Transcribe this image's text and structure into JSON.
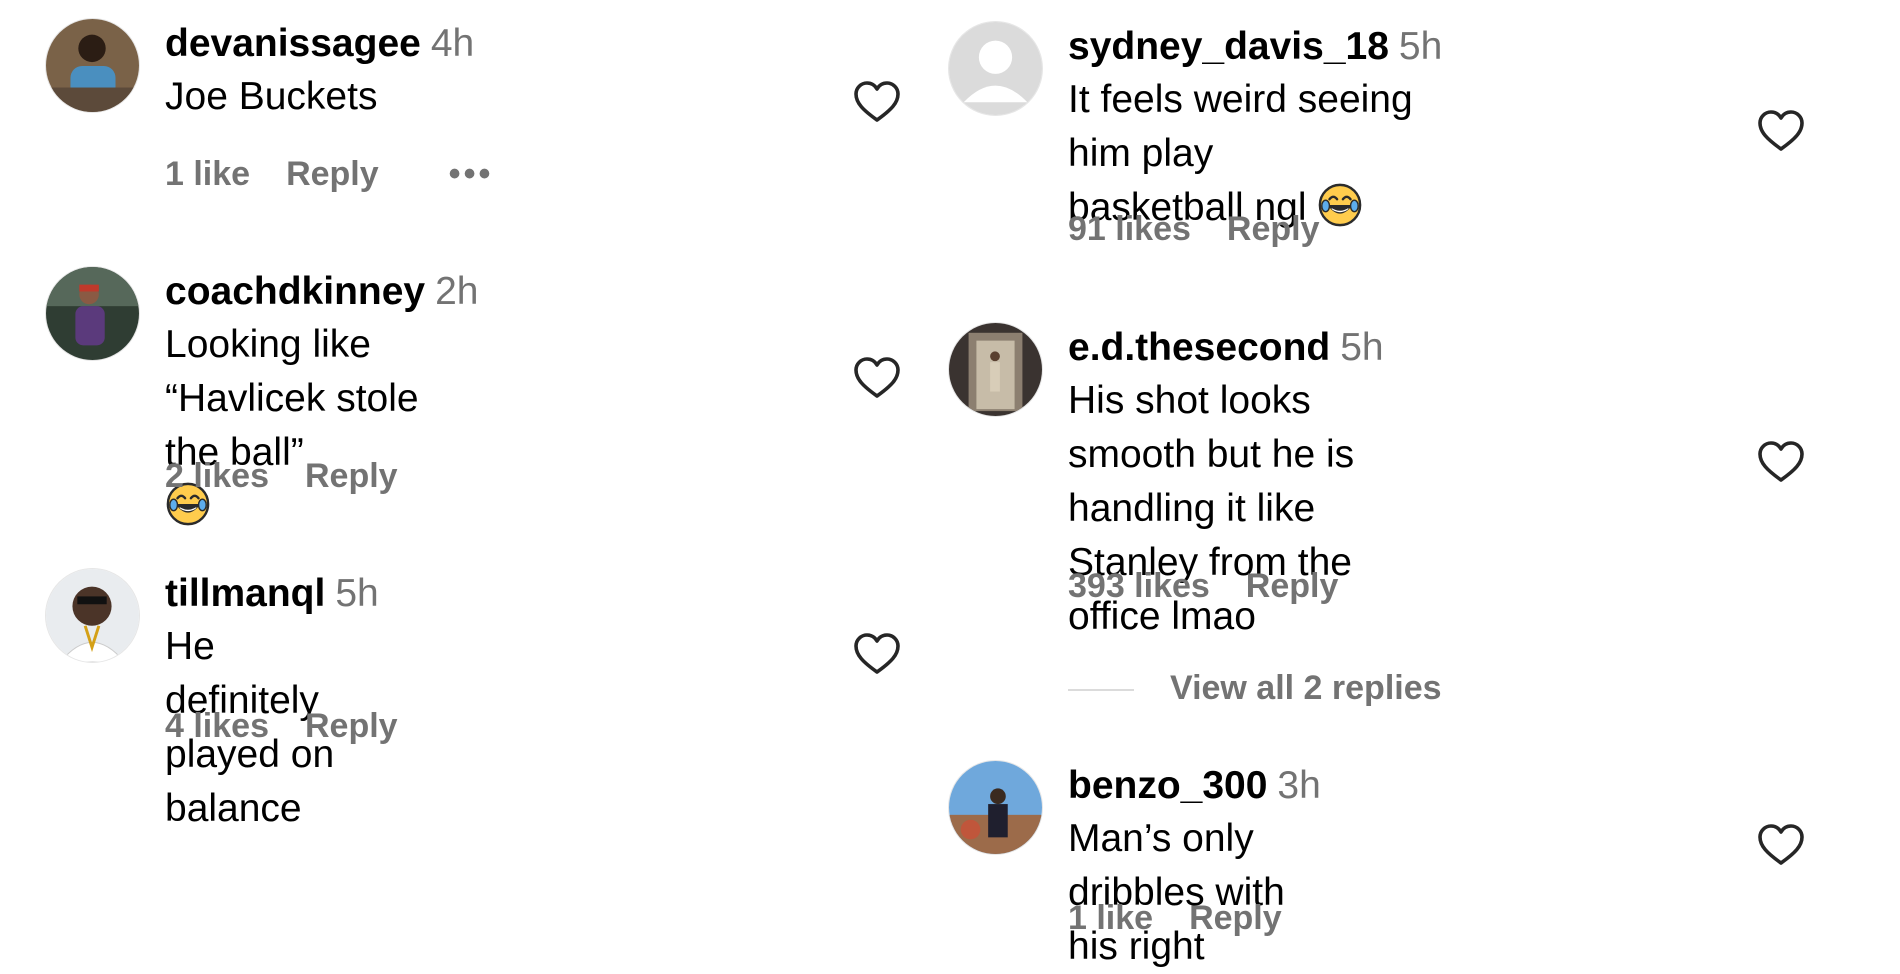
{
  "comments": [
    {
      "username": "devanissagee",
      "time": "4h",
      "text": "Joe Buckets",
      "likes": "1 like",
      "reply": "Reply",
      "more": "•••"
    },
    {
      "username": "coachdkinney",
      "time": "2h",
      "text": "Looking like “Havlicek stole the ball”",
      "likes": "2 likes",
      "reply": "Reply"
    },
    {
      "username": "tillmanql",
      "time": "5h",
      "text": "He definitely played on balance",
      "likes": "4 likes",
      "reply": "Reply"
    },
    {
      "username": "sydney_davis_18",
      "time": "5h",
      "text1": "It feels weird seeing him play",
      "text2": "basketball ngl",
      "likes": "91 likes",
      "reply": "Reply"
    },
    {
      "username": "e.d.thesecond",
      "time": "5h",
      "text1": "His shot looks smooth but he is",
      "text2": "handling it like Stanley from the",
      "text3": "office lmao",
      "likes": "393 likes",
      "reply": "Reply",
      "view_replies": "View all 2 replies"
    },
    {
      "username": "benzo_300",
      "time": "3h",
      "text": "Man’s only dribbles with his right",
      "likes": "1 like",
      "reply": "Reply"
    }
  ],
  "icons": {
    "like": "heart-outline-icon",
    "emoji": "face-with-tears-of-joy-emoji",
    "more": "more-options-icon"
  },
  "colors": {
    "text": "#000000",
    "secondary": "#737373",
    "divider": "#dbdbdb"
  }
}
